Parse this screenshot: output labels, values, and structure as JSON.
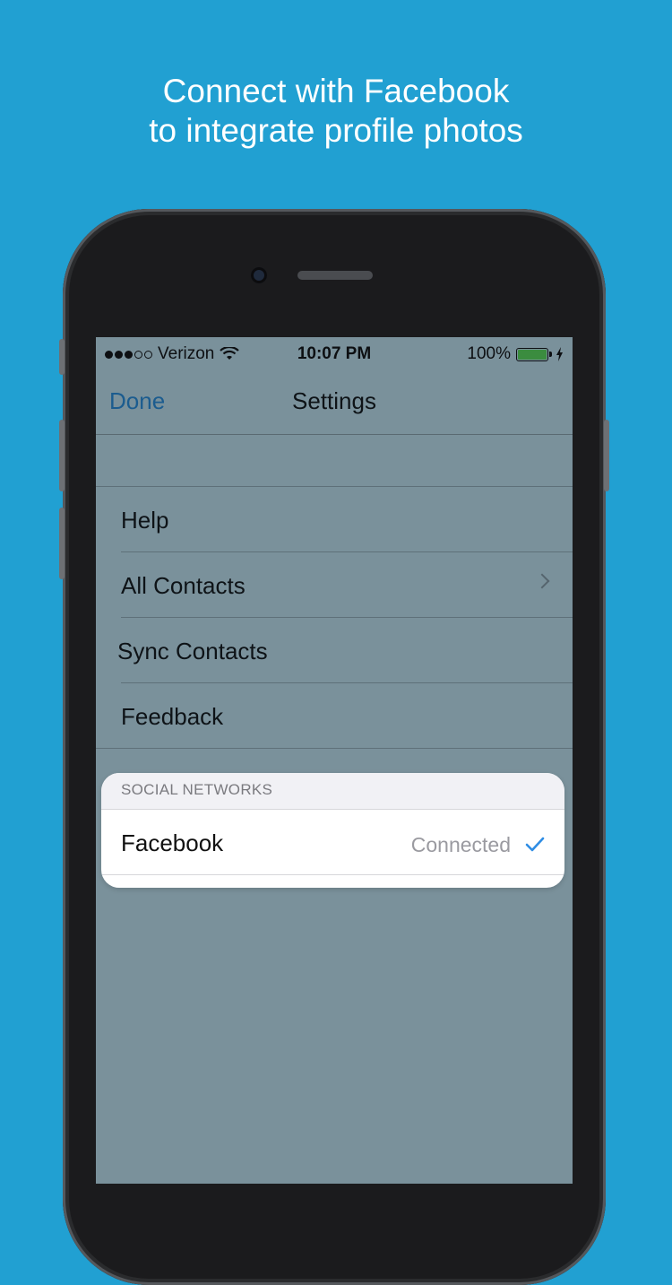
{
  "headline": {
    "line1": "Connect with Facebook",
    "line2": "to integrate profile photos"
  },
  "status_bar": {
    "signal_filled": 3,
    "signal_total": 5,
    "carrier": "Verizon",
    "time": "10:07 PM",
    "battery_percent": "100%",
    "battery_level": 1.0,
    "icons": [
      "wifi-icon",
      "battery-icon",
      "charging-bolt-icon"
    ]
  },
  "navbar": {
    "left_button": "Done",
    "title": "Settings"
  },
  "settings": {
    "items": [
      {
        "label": "Help"
      },
      {
        "label": "All Contacts",
        "icon": "chevron-right-icon"
      },
      {
        "label": "Sync Contacts"
      },
      {
        "label": "Feedback"
      }
    ]
  },
  "social": {
    "header": "SOCIAL NETWORKS",
    "row_label": "Facebook",
    "row_status": "Connected",
    "icon": "checkmark-icon"
  },
  "colors": {
    "background": "#21a0d2",
    "accent": "#1b5c8f",
    "check": "#2f8de4",
    "battery_fill": "#3b8c3f"
  }
}
